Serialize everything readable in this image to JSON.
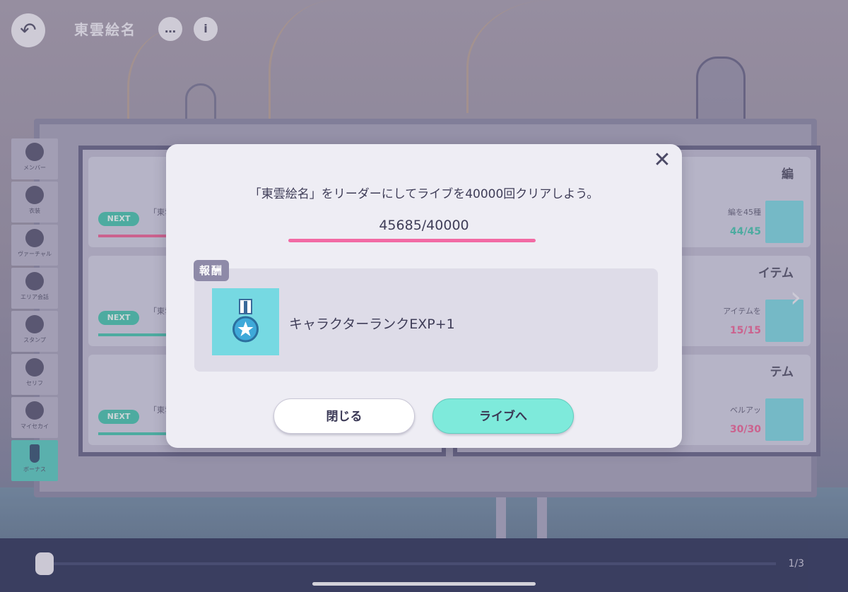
{
  "hud": {
    "back_symbol": "↶",
    "character_name": "東雲絵名",
    "chat_icon": "…",
    "info_icon": "i"
  },
  "side_tabs": [
    {
      "label": "メンバー"
    },
    {
      "label": "衣装"
    },
    {
      "label": "ヴァーチャル"
    },
    {
      "label": "エリア会話"
    },
    {
      "label": "スタンプ"
    },
    {
      "label": "セリフ"
    },
    {
      "label": "マイセカイ"
    },
    {
      "label": "ボーナス"
    }
  ],
  "background_cards": {
    "next_label": "NEXT",
    "left": [
      {
        "text": "「東雲 40000"
      },
      {
        "text": "「東雲"
      },
      {
        "text": "「東雲 演奏サ"
      }
    ],
    "right": [
      {
        "head": "編",
        "text": "編を45種",
        "count": "44/45",
        "count_color": "teal"
      },
      {
        "head": "イテム",
        "text": "アイテムを",
        "count": "15/15",
        "count_color": "pink"
      },
      {
        "head": "テム",
        "text": "ベルアッ",
        "count": "30/30",
        "count_color": "pink"
      }
    ]
  },
  "pager": {
    "page_indicator": "1/3",
    "next_arrow": "›"
  },
  "modal": {
    "close_symbol": "✕",
    "mission_text": "「東雲絵名」をリーダーにしてライブを40000回クリアしよう。",
    "progress_text": "45685/40000",
    "progress_fraction": 1.0,
    "reward_tag": "報酬",
    "reward_name": "キャラクターランクEXP+1",
    "reward_icon": "medal-star-icon",
    "close_button_label": "閉じる",
    "live_button_label": "ライブへ"
  },
  "colors": {
    "progress": "#f26aa4",
    "accent_teal": "#7eeadb",
    "reward_icon_bg": "#76d9e2"
  }
}
